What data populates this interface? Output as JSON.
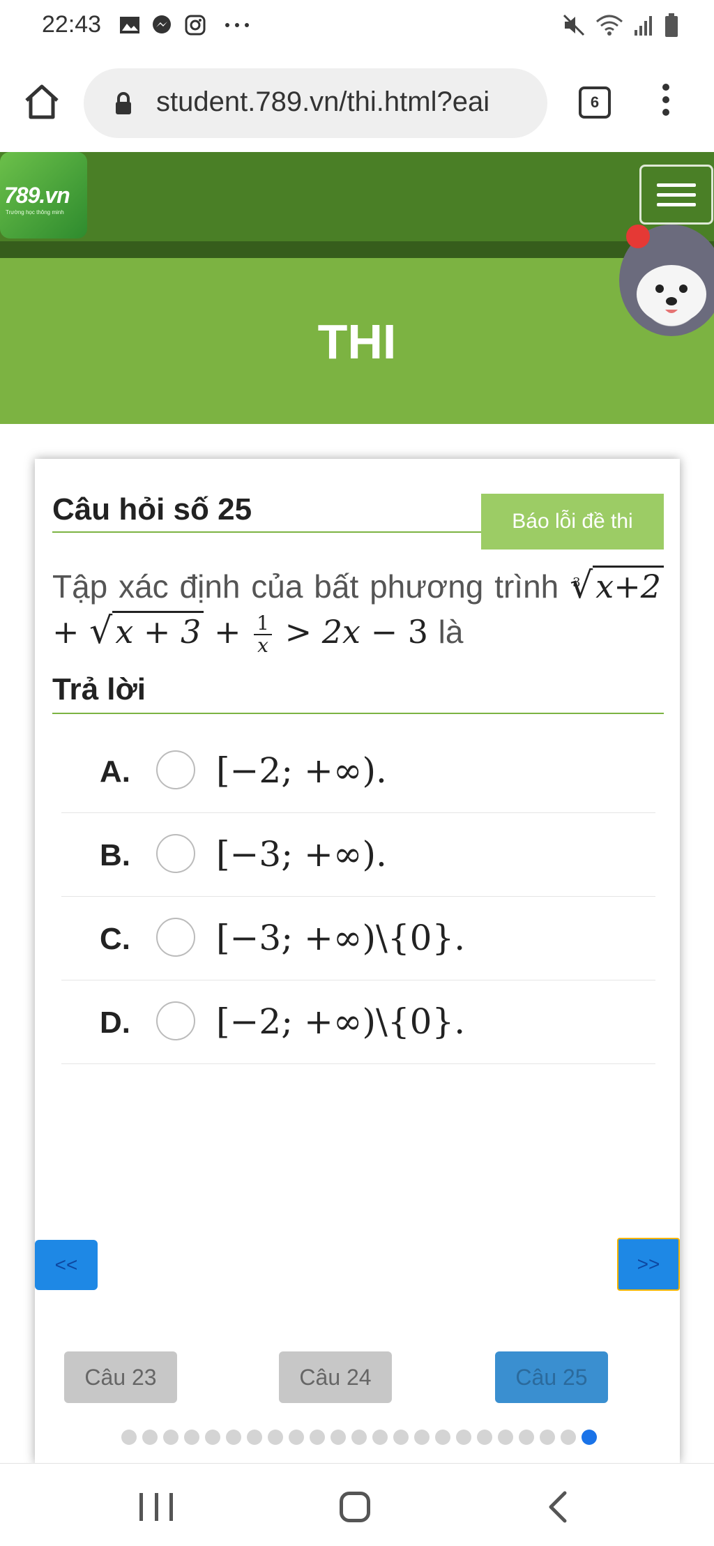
{
  "status_bar": {
    "time": "22:43",
    "left_icons": [
      "image-icon",
      "messenger-icon",
      "instagram-icon",
      "more-dots-icon"
    ],
    "right_icons": [
      "mute-icon",
      "wifi-icon",
      "signal-icon",
      "battery-icon"
    ]
  },
  "browser": {
    "url": "student.789.vn/thi.html?eai",
    "tab_count": "6"
  },
  "header": {
    "logo_text": "789.vn",
    "logo_subtext": "Trường học thông minh"
  },
  "banner": {
    "title": "THI"
  },
  "question": {
    "number_label": "Câu hỏi số 25",
    "report_label": "Báo lỗi đề thi",
    "text_prefix": "Tập xác định của bất phương trình",
    "text_suffix": "là",
    "answer_label": "Trả lời"
  },
  "options": [
    {
      "letter": "A.",
      "text": "[−2; +∞)."
    },
    {
      "letter": "B.",
      "text": "[−3; +∞)."
    },
    {
      "letter": "C.",
      "text": "[−3; +∞)\\{0}."
    },
    {
      "letter": "D.",
      "text": "[−2; +∞)\\{0}."
    }
  ],
  "navigation": {
    "prev_label": "<<",
    "next_label": ">>",
    "question_chips": [
      "Câu 23",
      "Câu 24",
      "Câu 25"
    ],
    "active_chip": "Câu 25",
    "dot_count": 23,
    "active_dot_index": 22
  },
  "colors": {
    "header_green": "#4a7f26",
    "banner_green": "#7cb342",
    "accent_light_green": "#9ccc65",
    "nav_blue": "#1e88e5"
  }
}
